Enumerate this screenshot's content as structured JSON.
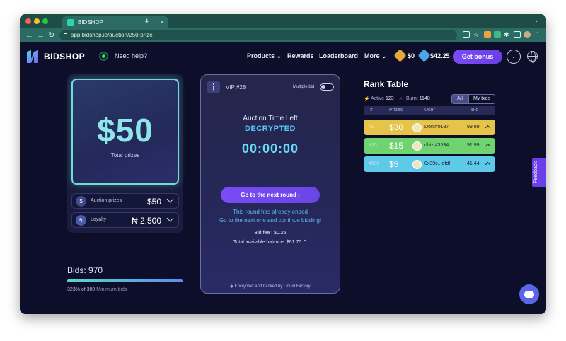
{
  "browser": {
    "tab_title": "BIDSHOP",
    "tab_close": "×",
    "new_tab": "+",
    "tab_dropdown": "⌄",
    "back": "←",
    "forward": "→",
    "reload": "↻",
    "url": "app.bidshop.io/auction/250-prize"
  },
  "header": {
    "logo_text": "BIDSHOP",
    "help_text": "Need help?",
    "menu": {
      "products": "Products",
      "rewards": "Rewards",
      "leaderboard": "Loaderboard",
      "more": "More"
    },
    "menu_chevron": "⌄",
    "balance_coin": "$0",
    "balance_main": "$42.25",
    "bonus_button": "Get bonus",
    "avatar_glyph": "⌄"
  },
  "prize": {
    "amount": "$50",
    "label": "Total prizes",
    "auction_prizes_label": "Auction prizes",
    "auction_prizes_value": "$50",
    "loyalty_label": "Loyalty",
    "loyalty_value": "₦ 2,500"
  },
  "bids": {
    "title": "Bids: 970",
    "progress_text": "323% of 300",
    "progress_suffix": "Minimum bids",
    "progress_fraction": 1.0
  },
  "auction": {
    "vip": "VIP #28",
    "multiple_bid_label": "Multiple bid",
    "time_title": "Auction Time Left",
    "status": "DECRYPTED",
    "clock": "00:00:00",
    "next_button": "Go to the next round  ›",
    "ended_line1": "This round has already ended",
    "ended_line2": "Go to the next one and continue bidding!",
    "bid_fee": "Bid fee :  $0.25",
    "available_balance": "Total available balance:  $61.75  ⌃",
    "footer": "Encrypted and backed by Liquid Factory"
  },
  "rank_table": {
    "title": "Rank Table",
    "active_label": "Active",
    "active_count": "123",
    "burnt_label": "Burnt",
    "burnt_count": "1148",
    "filter_all": "All",
    "filter_my": "My bids",
    "columns": [
      "#",
      "Prizes",
      "User",
      "Bid"
    ],
    "rows": [
      {
        "pos": "#1",
        "prize": "$30",
        "user": "Dont#0137",
        "bid": "99.89",
        "color": "#e6c44a"
      },
      {
        "pos": "#50",
        "prize": "$15",
        "user": "dhizt#3534",
        "bid": "91.99",
        "color": "#6fd36f"
      },
      {
        "pos": "#500",
        "prize": "$5",
        "user": "0x39c...efdf",
        "bid": "41.44",
        "color": "#5fc9e8"
      }
    ]
  },
  "feedback": "Feedback",
  "colors": {
    "accent": "#6a3ee8",
    "teal": "#6be0d0",
    "background": "#0d0f2a"
  },
  "icons": [
    "logo-icon",
    "help-dot-icon",
    "coin-icon",
    "gem-icon",
    "globe-icon",
    "dollar-icon",
    "loyalty-icon",
    "chevron-down-icon",
    "kebab-icon",
    "active-icon",
    "burnt-icon",
    "lock-icon",
    "discord-icon"
  ]
}
